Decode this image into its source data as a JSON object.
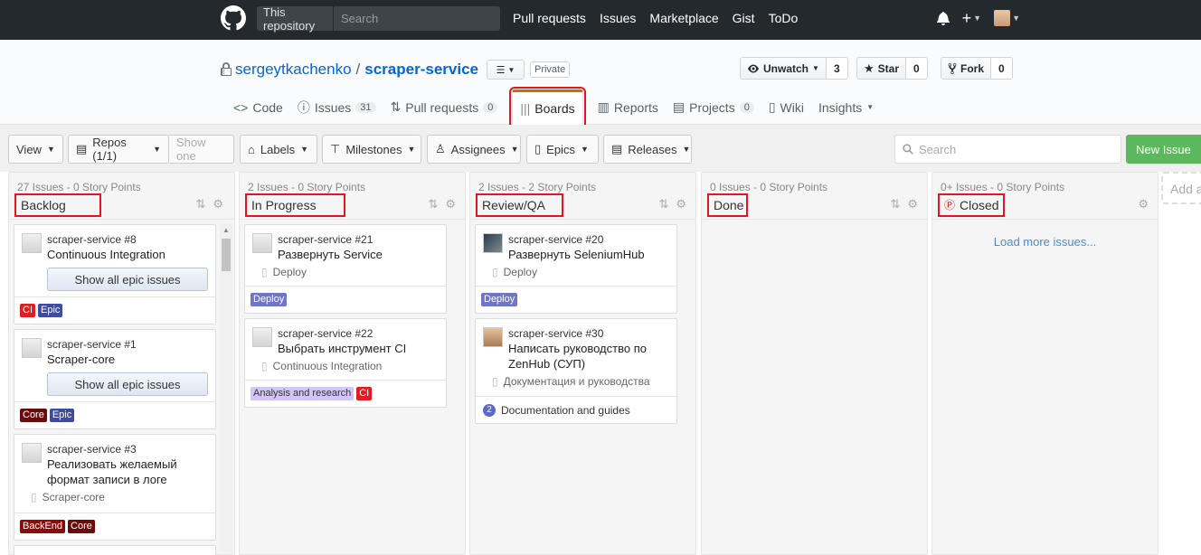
{
  "topbar": {
    "search_scope": "This repository",
    "search_placeholder": "Search",
    "nav": [
      "Pull requests",
      "Issues",
      "Marketplace",
      "Gist",
      "ToDo"
    ],
    "plus": "+"
  },
  "repo": {
    "owner": "sergeytkachenko",
    "separator": "/",
    "name": "scraper-service",
    "visibility": "Private",
    "watch_label": "Unwatch",
    "watch_count": "3",
    "star_label": "Star",
    "star_count": "0",
    "fork_label": "Fork",
    "fork_count": "0"
  },
  "tabs": [
    {
      "label": "Code",
      "icon": "code-icon"
    },
    {
      "label": "Issues",
      "count": "31",
      "icon": "issue-icon"
    },
    {
      "label": "Pull requests",
      "count": "0",
      "icon": "pr-icon"
    },
    {
      "label": "Boards",
      "icon": "boards-icon",
      "active": true
    },
    {
      "label": "Reports",
      "icon": "graph-icon"
    },
    {
      "label": "Projects",
      "count": "0",
      "icon": "project-icon"
    },
    {
      "label": "Wiki",
      "icon": "book-icon"
    },
    {
      "label": "Insights",
      "icon": "chevron-down-icon"
    }
  ],
  "toolbar": {
    "view": "View",
    "repos": "Repos (1/1)",
    "show_one": "Show one",
    "labels": "Labels",
    "milestones": "Milestones",
    "assignees": "Assignees",
    "epics": "Epics",
    "releases": "Releases",
    "search_placeholder": "Search",
    "new_issue": "New Issue"
  },
  "colors": {
    "highlight": "#e8141c",
    "ci": "#e11d21",
    "epic": "#3e4b9e",
    "core": "#6b0b0b",
    "backend": "#8b0a0a",
    "deploy": "#6f75c7",
    "analysis": "#d4c5f9",
    "new_issue": "#5cb85c"
  },
  "pipelines": [
    {
      "name": "Backlog",
      "meta": "27 Issues - 0 Story Points",
      "cards": [
        {
          "repo": "scraper-service #8",
          "title": "Continuous Integration",
          "button": "Show all epic issues",
          "labels": [
            {
              "text": "CI",
              "color": "#e11d21"
            },
            {
              "text": "Epic",
              "color": "#3e4b9e"
            }
          ]
        },
        {
          "repo": "scraper-service #1",
          "title": "Scraper-core",
          "button": "Show all epic issues",
          "labels": [
            {
              "text": "Core",
              "color": "#6b0b0b"
            },
            {
              "text": "Epic",
              "color": "#3e4b9e"
            }
          ]
        },
        {
          "repo": "scraper-service #3",
          "title": "Реализовать желаемый формат записи в логе",
          "epic": "Scraper-core",
          "labels": [
            {
              "text": "BackEnd",
              "color": "#8b0a0a"
            },
            {
              "text": "Core",
              "color": "#6b0b0b"
            }
          ]
        }
      ]
    },
    {
      "name": "In Progress",
      "meta": "2 Issues - 0 Story Points",
      "cards": [
        {
          "repo": "scraper-service #21",
          "title": "Развернуть Service",
          "epic": "Deploy",
          "labels": [
            {
              "text": "Deploy",
              "color": "#6f75c7"
            }
          ]
        },
        {
          "repo": "scraper-service #22",
          "title": "Выбрать инструмент CI",
          "epic": "Continuous Integration",
          "labels": [
            {
              "text": "Analysis and research",
              "color": "#d4c5f9"
            },
            {
              "text": "CI",
              "color": "#e11d21"
            }
          ]
        }
      ]
    },
    {
      "name": "Review/QA",
      "meta": "2 Issues - 2 Story Points",
      "cards": [
        {
          "repo": "scraper-service #20",
          "title": "Развернуть SeleniumHub",
          "epic": "Deploy",
          "labels": [
            {
              "text": "Deploy",
              "color": "#6f75c7"
            }
          ]
        },
        {
          "repo": "scraper-service #30",
          "title": "Написать руководство по ZenHub (СУП)",
          "epic": "Документация и руководства",
          "estimate": "2",
          "milestone": "Documentation and guides"
        }
      ]
    },
    {
      "name": "Done",
      "meta": "0 Issues - 0 Story Points",
      "cards": []
    },
    {
      "name": "Closed",
      "meta": "0+ Issues - 0 Story Points",
      "load_more": "Load more issues...",
      "cards": []
    }
  ],
  "add_pipeline": "Add a"
}
